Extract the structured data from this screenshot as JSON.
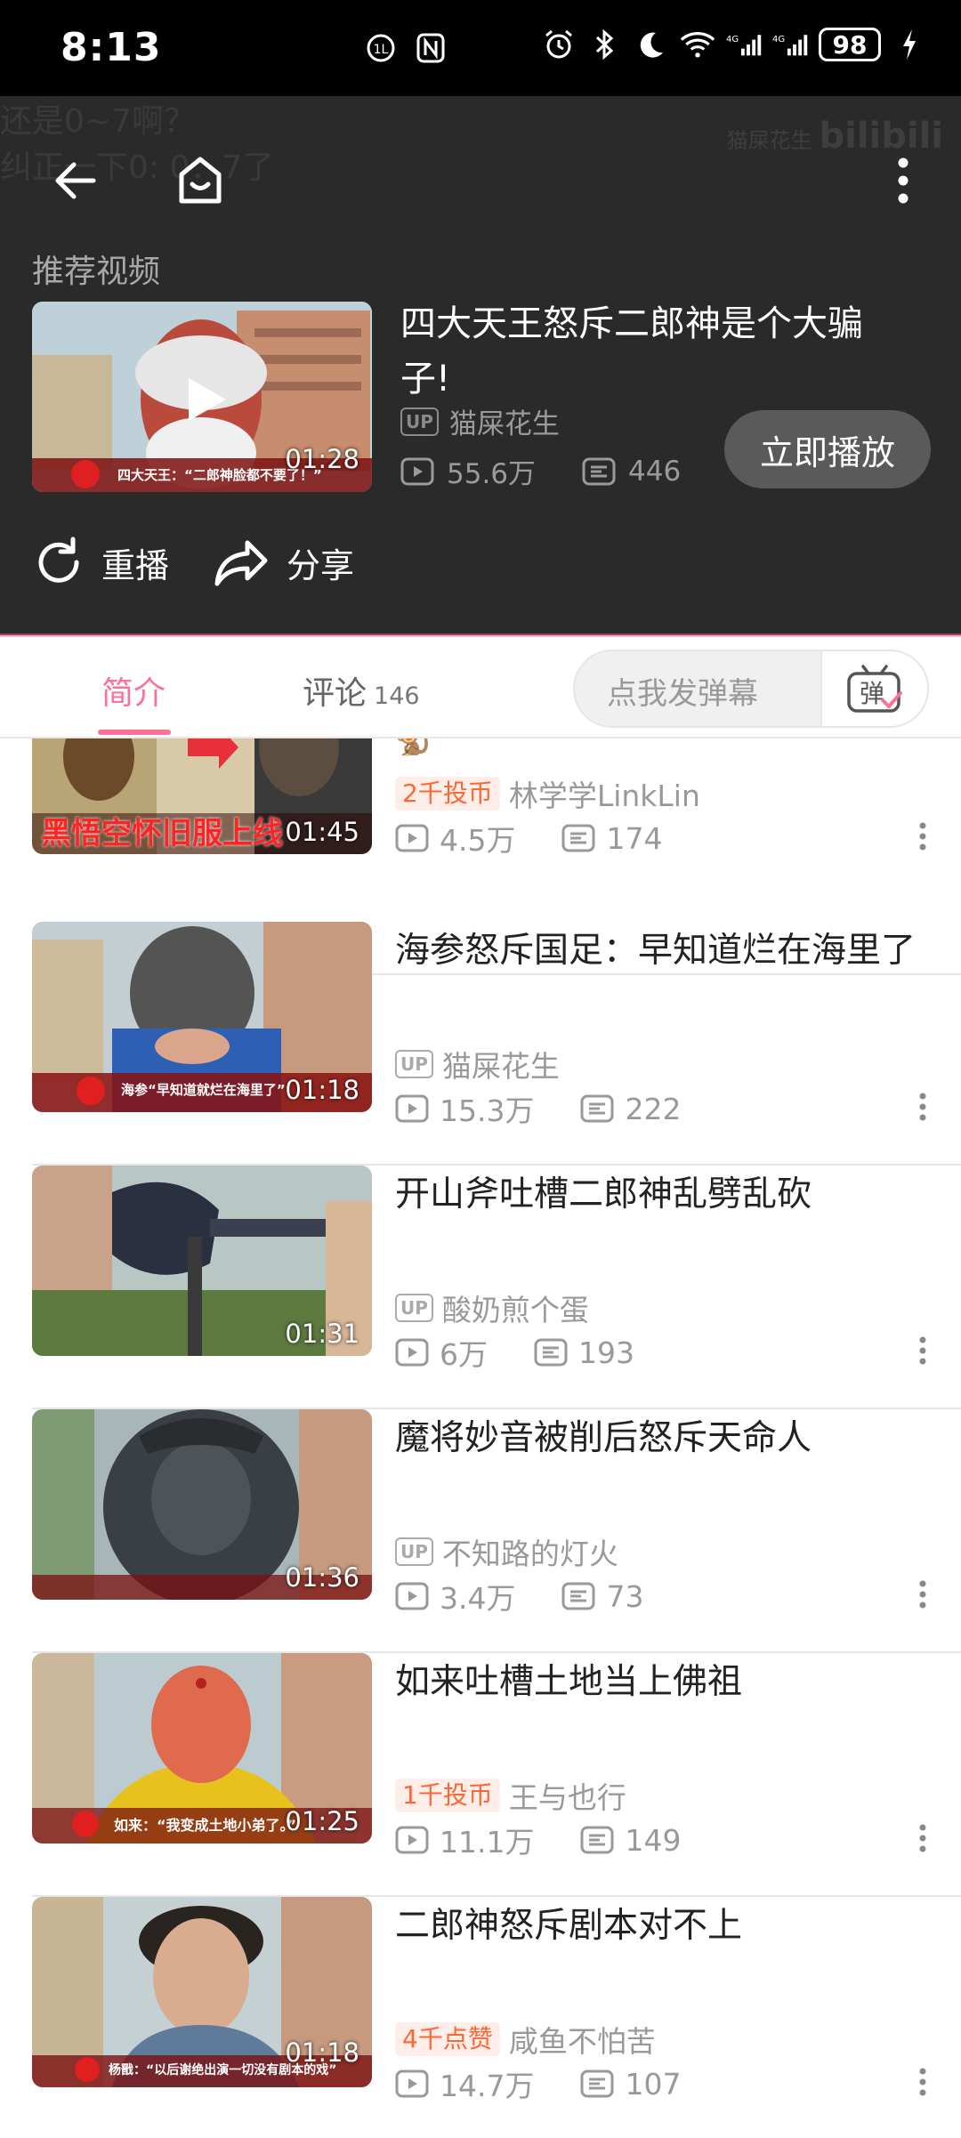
{
  "status_bar": {
    "time": "8:13",
    "battery": "98"
  },
  "player": {
    "ghost_line1": "还是0~7啊？",
    "ghost_line2": "纠正一下0:  0：7了",
    "watermark_user": "猫屎花生",
    "watermark_brand": "bilibili",
    "recommend_label": "推荐视频",
    "recommended": {
      "title": "四大天王怒斥二郎神是个大骗子!",
      "author": "猫屎花生",
      "views": "55.6万",
      "danmaku": "446",
      "duration": "01:28",
      "caption": "四大天王：“二郎神脸都不要了！”"
    },
    "play_now": "立即播放",
    "replay": "重播",
    "share": "分享"
  },
  "tabs": {
    "intro": "简介",
    "comments": "评论",
    "comments_count": "146",
    "danmaku_placeholder": "点我发弹幕",
    "danmaku_toggle": "弹"
  },
  "list": {
    "items": [
      {
        "emoji": "🐒",
        "badge": "2千投币",
        "author": "林学学LinkLin",
        "views": "4.5万",
        "danmaku": "174",
        "duration": "01:45",
        "thumb_text": "黑悟空怀旧服上线"
      },
      {
        "title": "海参怒斥国足：早知道烂在海里了",
        "author": "猫屎花生",
        "views": "15.3万",
        "danmaku": "222",
        "duration": "01:18",
        "caption": "海参“早知道就烂在海里了”"
      },
      {
        "title": "开山斧吐槽二郎神乱劈乱砍",
        "author": "酸奶煎个蛋",
        "views": "6万",
        "danmaku": "193",
        "duration": "01:31"
      },
      {
        "title": "魔将妙音被削后怒斥天命人",
        "author": "不知路的灯火",
        "views": "3.4万",
        "danmaku": "73",
        "duration": "01:36"
      },
      {
        "title": "如来吐槽土地当上佛祖",
        "badge": "1千投币",
        "author": "王与也行",
        "views": "11.1万",
        "danmaku": "149",
        "duration": "01:25",
        "caption": "如来：“我变成土地小弟了。”"
      },
      {
        "title": "二郎神怒斥剧本对不上",
        "badge": "4千点赞",
        "author": "咸鱼不怕苦",
        "views": "14.7万",
        "danmaku": "107",
        "duration": "01:18",
        "caption": "杨戬：“以后谢绝出演一切没有剧本的戏”"
      }
    ]
  },
  "colors": {
    "accent": "#fb7299",
    "player_bg": "#2a2a2a",
    "coin_badge": "#ff6633"
  },
  "icons": [
    "back-arrow-icon",
    "home-icon",
    "more-vertical-icon",
    "play-icon",
    "replay-icon",
    "share-icon",
    "views-icon",
    "danmaku-icon",
    "up-badge-icon",
    "danmaku-toggle-icon"
  ]
}
